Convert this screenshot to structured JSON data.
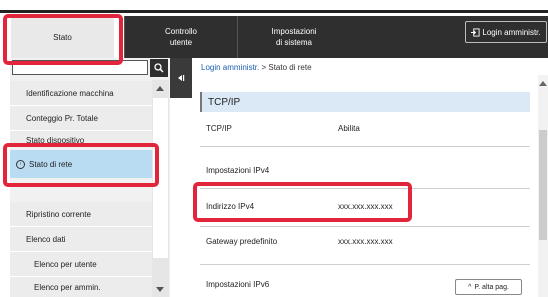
{
  "tabs": {
    "stato": "Stato",
    "controllo_line1": "Controllo",
    "controllo_line2": "utente",
    "impostazioni_line1": "Impostazioni",
    "impostazioni_line2": "di sistema"
  },
  "login_button": "Login amministr.",
  "sidebar": {
    "items": [
      "Identificazione macchina",
      "Conteggio Pr. Totale",
      "Stato dispositivo",
      "Stato di rete",
      "Ripristino corrente",
      "Elenco dati",
      "Elenco per utente",
      "Elenco per ammin."
    ]
  },
  "breadcrumb": {
    "link": "Login amministr.",
    "separator": " > ",
    "current": "Stato di rete"
  },
  "main": {
    "section_title": "TCP/IP",
    "rows": [
      {
        "label": "TCP/IP",
        "value": "Abilita"
      },
      {
        "label": "Impostazioni IPv4",
        "value": ""
      },
      {
        "label": "Indirizzo IPv4",
        "value": "xxx.xxx.xxx.xxx"
      },
      {
        "label": "Gateway predefinito",
        "value": "xxx.xxx.xxx.xxx"
      },
      {
        "label": "Impostazioni IPv6",
        "value": ""
      }
    ],
    "page_top_button": "P. alta pag."
  },
  "colors": {
    "highlight": "#e2253a",
    "active_item": "#b9dcf3",
    "dark_tab": "#2f2f2f",
    "link": "#1b5fb3"
  }
}
